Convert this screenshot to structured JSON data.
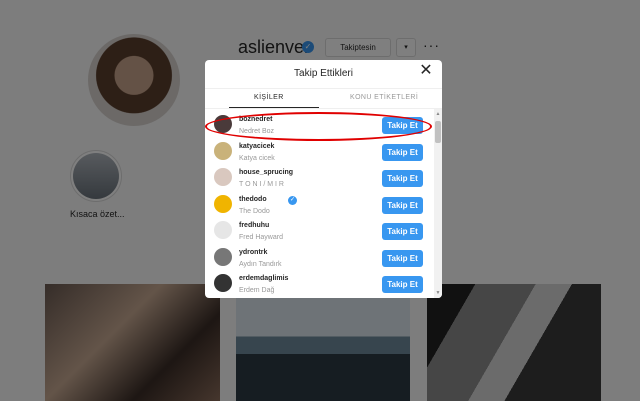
{
  "profile": {
    "username": "aslienver",
    "follow_label": "Takiptesin",
    "dropdown_label": "▾",
    "more_label": "···",
    "highlight_label": "Kısaca özet..."
  },
  "modal": {
    "title": "Takip Ettikleri",
    "close_label": "✕",
    "tabs": {
      "people": "KİŞİLER",
      "topics": "KONU ETİKETLERİ"
    },
    "rows": [
      {
        "username": "boznedret",
        "name": "Nedret Boz",
        "button": "Takip Et",
        "avatar_color": "#4a3a3a"
      },
      {
        "username": "katyacicek",
        "name": "Katya cicek",
        "button": "Takip Et",
        "avatar_color": "#c9b27a"
      },
      {
        "username": "house_sprucing",
        "name": "T O N I / M I R",
        "button": "Takip Et",
        "avatar_color": "#d9c8bf"
      },
      {
        "username": "thedodo",
        "name": "The Dodo",
        "button": "Takip Et",
        "avatar_color": "#f0b400",
        "verified": true
      },
      {
        "username": "fredhuhu",
        "name": "Fred Hayward",
        "button": "Takip Et",
        "avatar_color": "#e6e6e6"
      },
      {
        "username": "ydrontrk",
        "name": "Aydın Tandırk",
        "button": "Takip Et",
        "avatar_color": "#777777"
      },
      {
        "username": "erdemdaglimis",
        "name": "Erdem Dağ",
        "button": "Takip Et",
        "avatar_color": "#333333"
      }
    ]
  },
  "colors": {
    "accent": "#3897f0",
    "annotation": "#e00000"
  }
}
